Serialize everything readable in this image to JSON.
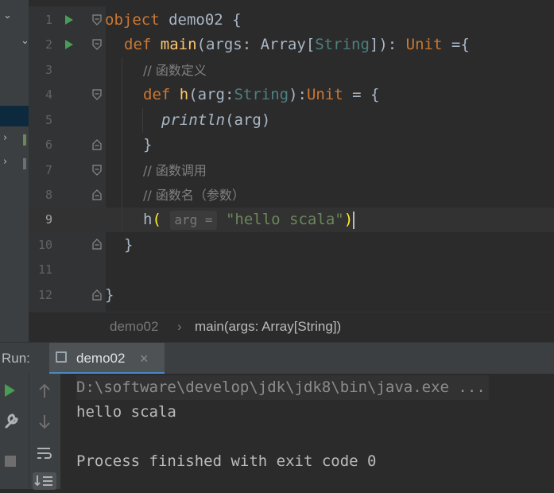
{
  "editor": {
    "line_numbers": [
      "1",
      "2",
      "3",
      "4",
      "5",
      "6",
      "7",
      "8",
      "9",
      "10",
      "11",
      "12"
    ],
    "lines": {
      "l1": {
        "kw": "object",
        "name": "demo02",
        "rest": " {"
      },
      "l2": {
        "kw": "def",
        "fn": "main",
        "p1": "(args: Array[",
        "ty": "String",
        "p2": "]): ",
        "ret": "Unit",
        "p3": " ={"
      },
      "l3": {
        "comment": "// 函数定义"
      },
      "l4": {
        "kw": "def",
        "fn": "h",
        "p1": "(arg:",
        "ty": "String",
        "p2": "):",
        "ret": "Unit",
        "p3": " = {"
      },
      "l5": {
        "call": "println",
        "args": "(arg)"
      },
      "l6": {
        "text": "}"
      },
      "l7": {
        "comment": "// 函数调用"
      },
      "l8": {
        "comment": "// 函数名（参数）"
      },
      "l9": {
        "fn": "h",
        "open": "(",
        "hint": "arg =",
        "str": "\"hello scala\"",
        "close": ")"
      },
      "l10": {
        "text": "}"
      },
      "l12": {
        "text": "}"
      }
    }
  },
  "breadcrumb": {
    "items": [
      "demo02",
      "main(args: Array[String])"
    ],
    "separator": "›"
  },
  "run_panel": {
    "label": "Run:",
    "tab_label": "demo02",
    "tab_close": "×",
    "console": [
      "D:\\software\\develop\\jdk\\jdk8\\bin\\java.exe ...",
      "hello scala",
      "",
      "Process finished with exit code 0"
    ]
  },
  "colors": {
    "keyword": "#cc7832",
    "function": "#ffc66d",
    "string": "#6a8759",
    "comment": "#808080",
    "run_green": "#499c54"
  }
}
